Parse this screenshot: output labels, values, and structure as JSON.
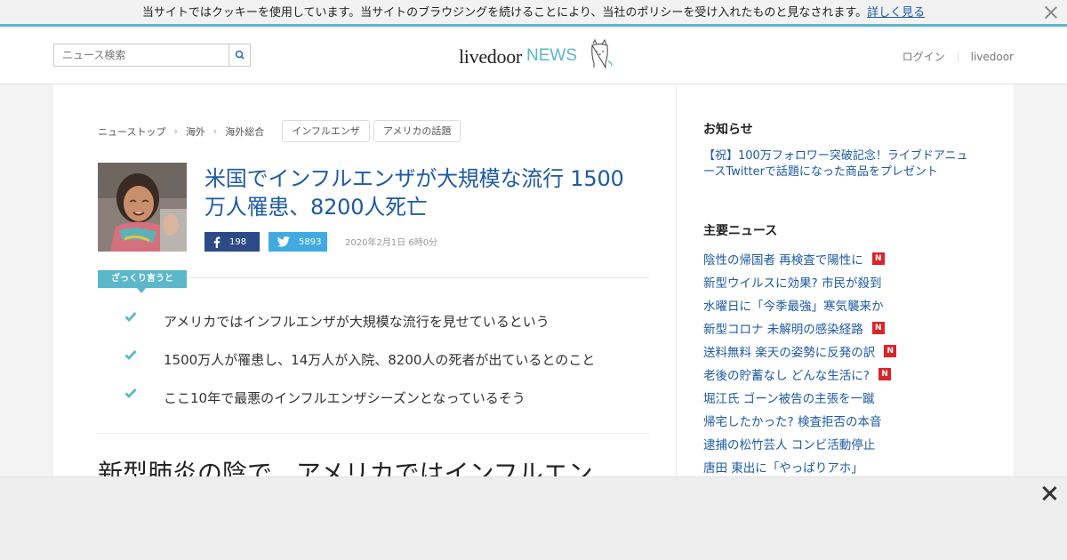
{
  "cookie_bar": {
    "message": "当サイトではクッキーを使用しています。当サイトのブラウジングを続けることにより、当社のポリシーを受け入れたものと見なされます。",
    "link_label": "詳しく見る",
    "close_icon": "close-icon"
  },
  "header": {
    "search_placeholder": "ニュース検索",
    "search_icon": "search-icon",
    "logo_livedoor": "livedoor",
    "logo_news": "NEWS",
    "links": [
      "ログイン",
      "livedoor"
    ],
    "accent_color": "#5bb7c9"
  },
  "breadcrumb": [
    "ニューストップ",
    "海外",
    "海外総合"
  ],
  "tags": [
    "インフルエンザ",
    "アメリカの話題"
  ],
  "article": {
    "title": "米国でインフルエンザが大規模な流行 1500万人罹患、8200人死亡",
    "facebook_count": "198",
    "twitter_count": "5893",
    "date": "2020年2月1日 6時0分",
    "summary_label": "ざっくり言うと",
    "summary_points": [
      "アメリカではインフルエンザが大規模な流行を見せているという",
      "1500万人が罹患し、14万人が入院、8200人の死者が出ているとのこと",
      "ここ10年で最悪のインフルエンザシーズンとなっているそう"
    ],
    "body_heading": "新型肺炎の陰で、アメリカではインフルエン"
  },
  "sidebar": {
    "notice_heading": "お知らせ",
    "notice_text": "【祝】100万フォロワー突破記念！ライブドアニュースTwitterで話題になった商品をプレゼント",
    "news_heading": "主要ニュース",
    "news_items": [
      {
        "label": "陰性の帰国者 再検査で陽性に",
        "new": true
      },
      {
        "label": "新型ウイルスに効果? 市民が殺到",
        "new": false
      },
      {
        "label": "水曜日に「今季最強」寒気襲来か",
        "new": false
      },
      {
        "label": "新型コロナ 未解明の感染経路",
        "new": true
      },
      {
        "label": "送料無料 楽天の姿勢に反発の訳",
        "new": true
      },
      {
        "label": "老後の貯蓄なし どんな生活に?",
        "new": true
      },
      {
        "label": "堀江氏 ゴーン被告の主張を一蹴",
        "new": false
      },
      {
        "label": "帰宅したかった? 検査拒否の本音",
        "new": false
      },
      {
        "label": "逮捕の松竹芸人 コンビ活動停止",
        "new": false
      },
      {
        "label": "唐田 東出に「やっぱりアホ」",
        "new": false
      }
    ],
    "new_badge": "N",
    "badge_color": "#d9252a"
  }
}
